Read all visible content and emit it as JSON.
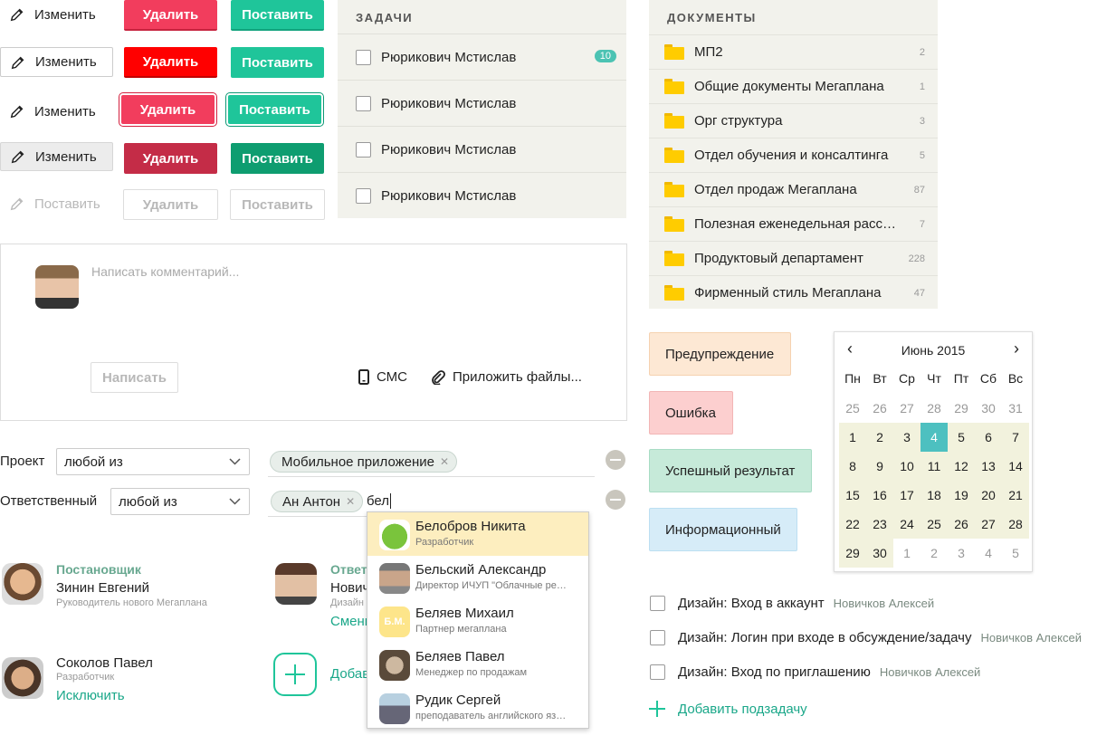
{
  "buttons": {
    "edit": "Изменить",
    "delete": "Удалить",
    "put": "Поставить"
  },
  "tasks": {
    "title": "ЗАДАЧИ",
    "items": [
      {
        "name": "Рюрикович Мстислав",
        "badge": "10"
      },
      {
        "name": "Рюрикович Мстислав",
        "badge": ""
      },
      {
        "name": "Рюрикович Мстислав",
        "badge": ""
      },
      {
        "name": "Рюрикович Мстислав",
        "badge": ""
      }
    ]
  },
  "documents": {
    "title": "ДОКУМЕНТЫ",
    "items": [
      {
        "name": "МП2",
        "count": "2"
      },
      {
        "name": "Общие документы Мегаплана",
        "count": "1"
      },
      {
        "name": "Орг структура",
        "count": "3"
      },
      {
        "name": "Отдел обучения и консалтинга",
        "count": "5"
      },
      {
        "name": "Отдел продаж Мегаплана",
        "count": "87"
      },
      {
        "name": "Полезная еженедельная расс…",
        "count": "7"
      },
      {
        "name": "Продуктовый департамент",
        "count": "228"
      },
      {
        "name": "Фирменный стиль Мегаплана",
        "count": "47"
      }
    ]
  },
  "comment": {
    "placeholder": "Написать комментарий...",
    "submit": "Написать",
    "sms": "СМС",
    "attach": "Приложить файлы..."
  },
  "alerts": {
    "warning": "Предупреждение",
    "error": "Ошибка",
    "success": "Успешный результат",
    "info": "Информационный"
  },
  "calendar": {
    "month": "Июнь 2015",
    "prev": "‹",
    "next": "›",
    "weekdays": [
      "Пн",
      "Вт",
      "Ср",
      "Чт",
      "Пт",
      "Сб",
      "Вс"
    ],
    "weeks": [
      [
        "25",
        "26",
        "27",
        "28",
        "29",
        "30",
        "31"
      ],
      [
        "1",
        "2",
        "3",
        "4",
        "5",
        "6",
        "7"
      ],
      [
        "8",
        "9",
        "10",
        "11",
        "12",
        "13",
        "14"
      ],
      [
        "15",
        "16",
        "17",
        "18",
        "19",
        "20",
        "21"
      ],
      [
        "22",
        "23",
        "24",
        "25",
        "26",
        "27",
        "28"
      ],
      [
        "29",
        "30",
        "1",
        "2",
        "3",
        "4",
        "5"
      ]
    ],
    "selected": "4"
  },
  "filters": {
    "project_label": "Проект",
    "project_select": "любой из",
    "project_chip": "Мобильное приложение",
    "responsible_label": "Ответственный",
    "responsible_select": "любой из",
    "responsible_chip": "Ан Антон",
    "responsible_input": "бел"
  },
  "dropdown": [
    {
      "name": "Белобров Никита",
      "sub": "Разработчик"
    },
    {
      "name": "Бельский Александр",
      "sub": "Директор ИЧУП \"Облачные ре…"
    },
    {
      "name": "Беляев Михаил",
      "sub": "Партнер мегаплана",
      "initials": "Б.М."
    },
    {
      "name": "Беляев Павел",
      "sub": "Менеджер по продажам"
    },
    {
      "name": "Рудик Сергей",
      "sub": "преподаватель английского яз…"
    }
  ],
  "people": {
    "director_role": "Постановщик",
    "director_name": "Зинин Евгений",
    "director_title": "Руководитель нового Мегаплана",
    "resp_role": "Ответ",
    "resp_name": "Нович",
    "resp_title": "Дизайн",
    "resp_change": "Смени",
    "member_name": "Соколов Павел",
    "member_title": "Разработчик",
    "member_remove": "Исключить",
    "add_label": "Добав"
  },
  "subtasks": {
    "items": [
      {
        "title": "Дизайн: Вход в аккаунт",
        "owner": "Новичков Алексей"
      },
      {
        "title": "Дизайн: Логин при входе в обсуждение/задачу",
        "owner": "Новичков Алексей"
      },
      {
        "title": "Дизайн: Вход по приглашению",
        "owner": "Новичков Алексей"
      }
    ],
    "add": "Добавить подзадачу"
  },
  "colors": {
    "accent": "#1fc59a",
    "danger": "#f23d5d",
    "teal_text": "#1aa789",
    "calendar_selected": "#4dc0c0",
    "folder": "#ffcc00"
  }
}
